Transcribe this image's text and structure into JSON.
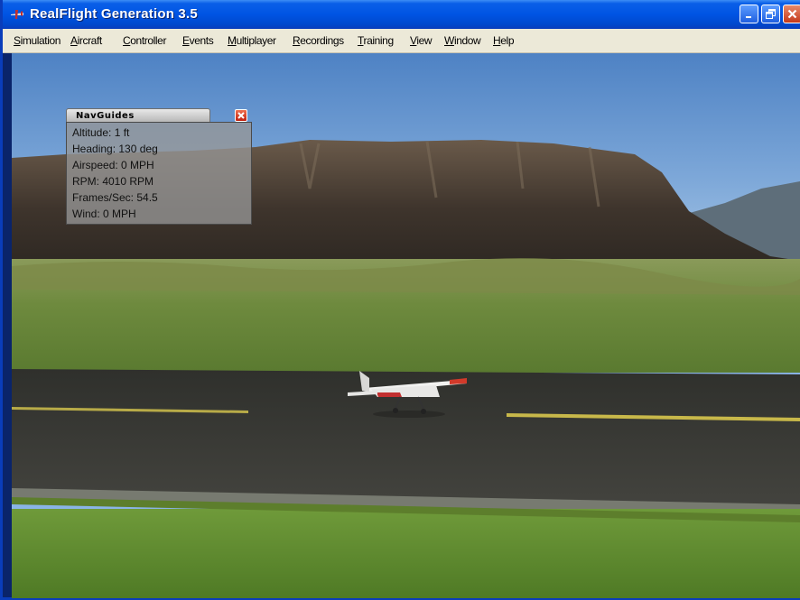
{
  "window": {
    "title": "RealFlight Generation 3.5"
  },
  "menubar": {
    "items": [
      {
        "u": "S",
        "rest": "imulation"
      },
      {
        "u": "A",
        "rest": "ircraft"
      },
      {
        "u": "C",
        "rest": "ontroller"
      },
      {
        "u": "E",
        "rest": "vents"
      },
      {
        "u": "M",
        "rest": "ultiplayer"
      },
      {
        "u": "R",
        "rest": "ecordings"
      },
      {
        "u": "T",
        "rest": "raining"
      },
      {
        "u": "V",
        "rest": "iew"
      },
      {
        "u": "W",
        "rest": "indow"
      },
      {
        "u": "H",
        "rest": "elp"
      }
    ]
  },
  "navguides": {
    "title": "NavGuides",
    "rows": [
      "Altitude: 1 ft",
      "Heading: 130 deg",
      "Airspeed: 0 MPH",
      "RPM: 4010 RPM",
      "Frames/Sec: 54.5",
      "Wind: 0 MPH"
    ]
  },
  "colors": {
    "titlebar": "#0054e3",
    "menubar": "#ece9d8",
    "sky": "#6f9fd8",
    "grass": "#6a8a3a",
    "runway": "#3a3a36",
    "runway_stripe": "#c8b84a"
  },
  "icons": {
    "app": "airplane-icon",
    "minimize": "minimize-icon",
    "maximize": "restore-icon",
    "close": "close-icon",
    "hud_close": "close-icon"
  }
}
